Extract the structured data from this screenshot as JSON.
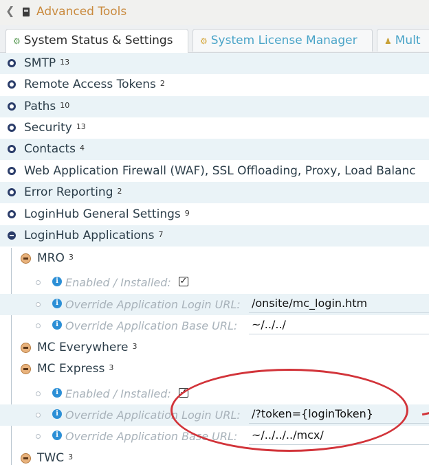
{
  "header": {
    "back_icon": "chevron-left-icon",
    "tool_icon": "toolbox-icon",
    "title": "Advanced Tools"
  },
  "tabs": [
    {
      "icon": "gears-icon",
      "label": "System Status & Settings",
      "active": true
    },
    {
      "icon": "key-icon",
      "label": "System License Manager",
      "active": false
    },
    {
      "icon": "users-icon",
      "label": "Mult",
      "active": false
    }
  ],
  "categories": [
    {
      "label": "SMTP",
      "count": "13"
    },
    {
      "label": "Remote Access Tokens",
      "count": "2"
    },
    {
      "label": "Paths",
      "count": "10"
    },
    {
      "label": "Security",
      "count": "13"
    },
    {
      "label": "Contacts",
      "count": "4"
    },
    {
      "label": "Web Application Firewall (WAF), SSL Offloading, Proxy, Load Balanc",
      "count": ""
    },
    {
      "label": "Error Reporting",
      "count": "2"
    },
    {
      "label": "LoginHub General Settings",
      "count": "9"
    },
    {
      "label": "LoginHub Applications",
      "count": "7"
    }
  ],
  "apps": {
    "mro": {
      "label": "MRO",
      "count": "3"
    },
    "mro_settings": [
      {
        "label": "Enabled / Installed:",
        "value": "",
        "checked": true
      },
      {
        "label": "Override Application Login URL:",
        "value": "/onsite/mc_login.htm"
      },
      {
        "label": "Override Application Base URL:",
        "value": "~/../../"
      }
    ],
    "mc_everywhere": {
      "label": "MC Everywhere",
      "count": "3"
    },
    "mc_express": {
      "label": "MC Express",
      "count": "3"
    },
    "mc_express_settings": [
      {
        "label": "Enabled / Installed:",
        "value": "",
        "checked": true
      },
      {
        "label": "Override Application Login URL:",
        "value": "/?token={loginToken}"
      },
      {
        "label": "Override Application Base URL:",
        "value": "~/../../../mcx/"
      }
    ],
    "twc": {
      "label": "TWC",
      "count": "3"
    }
  },
  "colors": {
    "accent": "#4aa4c8",
    "header_title": "#c98a3e",
    "annotation": "#d2343a",
    "row_shade": "#eaf3f7"
  }
}
